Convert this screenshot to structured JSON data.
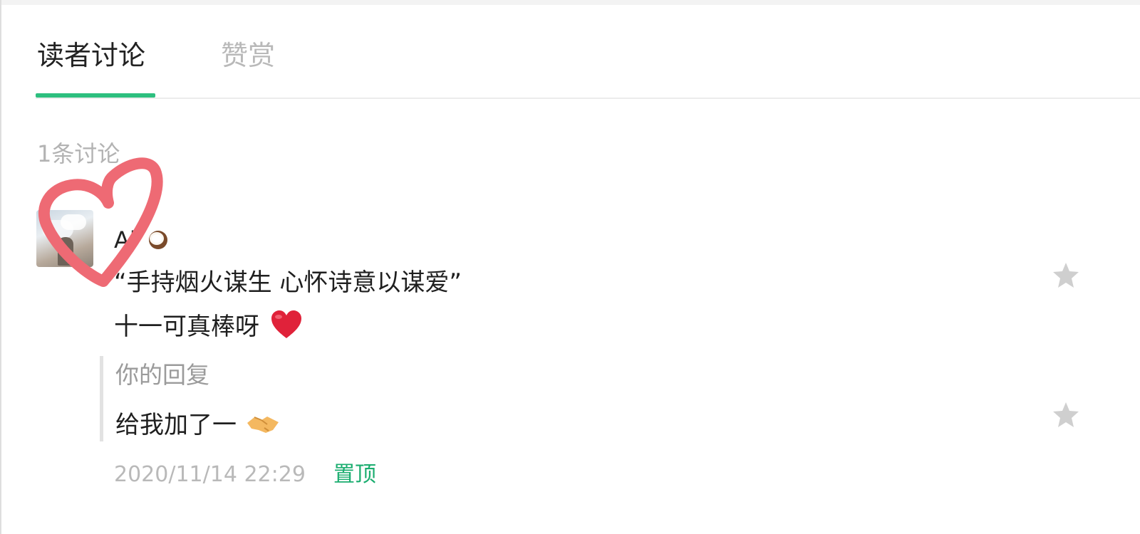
{
  "tabs": [
    {
      "label": "读者讨论",
      "active": true
    },
    {
      "label": "赞赏",
      "active": false
    }
  ],
  "discussion_count": "1条讨论",
  "comment": {
    "username": "Al",
    "username_emoji": "coconut-emoji",
    "line1": "“手持烟火谋生 心怀诗意以谋爱”",
    "line2": "十一可真棒呀",
    "line2_emoji": "red-heart-emoji",
    "reply": {
      "label": "你的回复",
      "text": "给我加了一",
      "emoji": "handshake-emoji"
    },
    "timestamp": "2020/11/14 22:29",
    "pin_label": "置顶"
  },
  "icons": {
    "star": "star-icon",
    "overlay": "hand-drawn-heart-doodle"
  },
  "colors": {
    "accent_green": "#1aad6f",
    "indicator_green": "#2dbf7f",
    "doodle_red": "#ee6a74",
    "text_dark": "#1f1f1f",
    "text_muted": "#b9b9b9",
    "star_gray": "#cfcfcf"
  }
}
